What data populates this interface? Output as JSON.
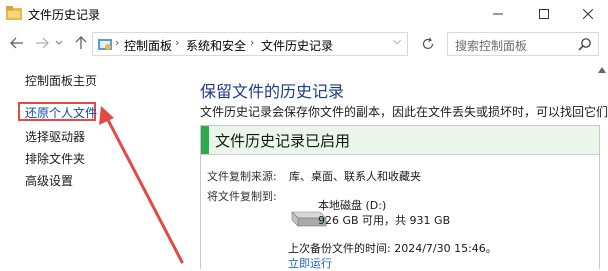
{
  "window": {
    "title": "文件历史记录",
    "min_icon": "minimize-icon",
    "max_icon": "maximize-icon",
    "close_icon": "close-icon"
  },
  "nav": {
    "back_icon": "arrow-left-icon",
    "forward_icon": "arrow-right-icon",
    "recent_icon": "chevron-down-icon",
    "up_icon": "arrow-up-icon",
    "breadcrumb": [
      "控制面板",
      "系统和安全",
      "文件历史记录"
    ],
    "refresh_icon": "refresh-icon",
    "search_placeholder": "搜索控制面板"
  },
  "leftnav": {
    "items": [
      "控制面板主页",
      "还原个人文件",
      "选择驱动器",
      "排除文件夹",
      "高级设置"
    ],
    "selected": "还原个人文件",
    "highlight_color": "#e24a43"
  },
  "main": {
    "heading": "保留文件的历史记录",
    "description": "文件历史记录会保存你文件的副本，因此在文件丢失或损坏时，可以找回它们。",
    "status": "文件历史记录已启用",
    "status_color": "#2fa84f",
    "copy_source_label": "文件复制来源:",
    "copy_source_value": "库、桌面、联系人和收藏夹",
    "copy_dest_label": "将文件复制到:",
    "drive_name": "本地磁盘 (D:)",
    "drive_space": "926 GB 可用，共 931 GB",
    "last_backup": "上次备份文件的时间: 2024/7/30 15:46。",
    "run_now": "立即运行"
  }
}
